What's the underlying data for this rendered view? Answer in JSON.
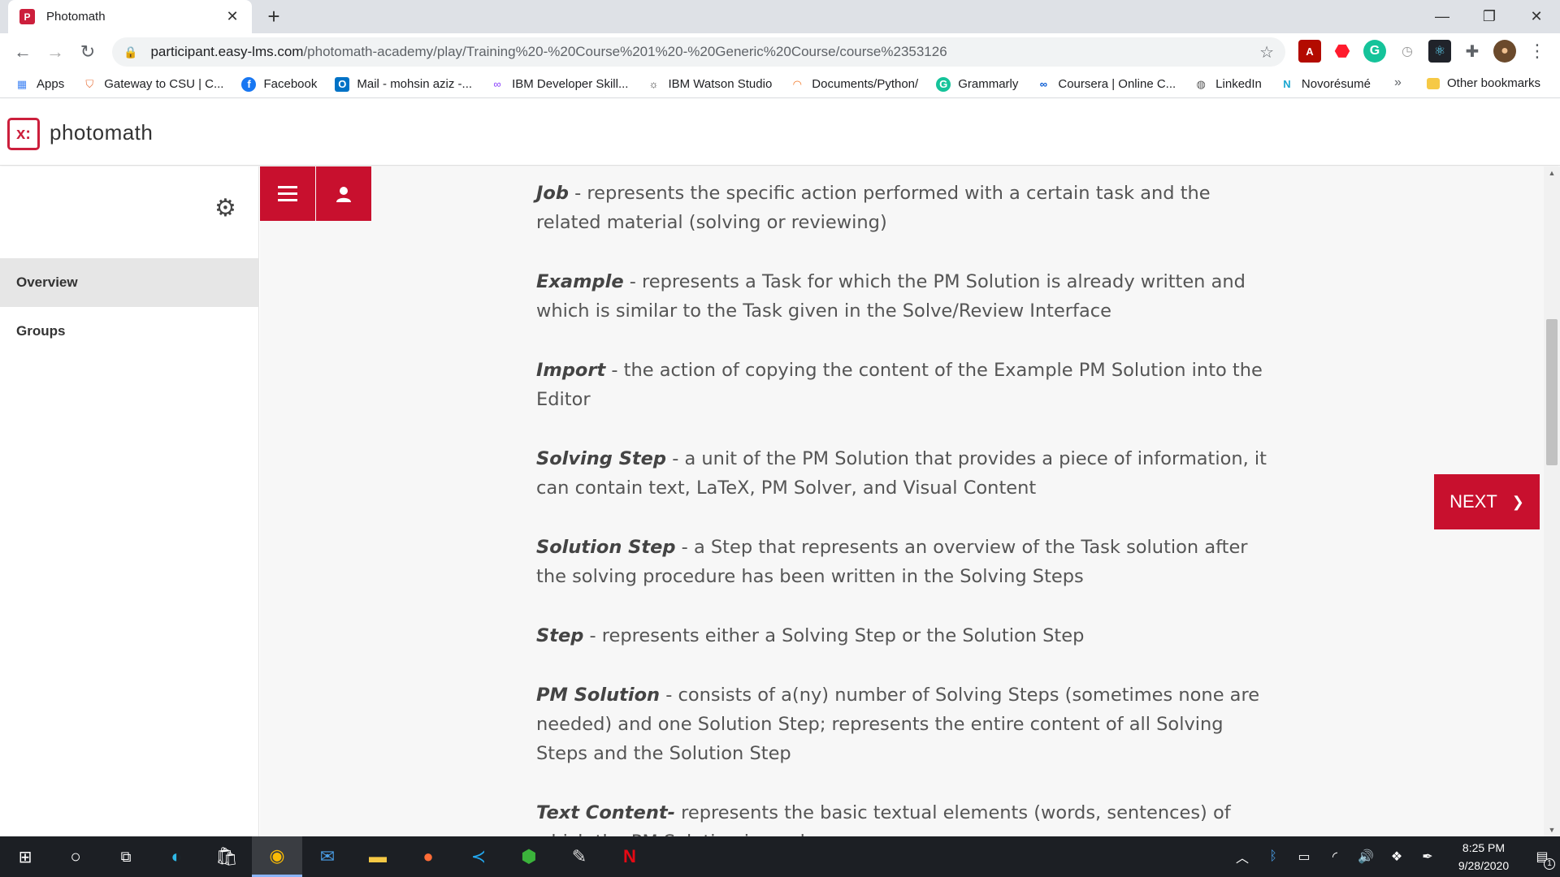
{
  "browser": {
    "tab": {
      "favicon_letter": "P",
      "title": "Photomath"
    },
    "url_domain": "participant.easy-lms.com",
    "url_path": "/photomath-academy/play/Training%20-%20Course%201%20-%20Generic%20Course/course%2353126",
    "bookmarks": [
      {
        "label": "Apps",
        "icon": "apps-grid-icon",
        "color": "#4285f4"
      },
      {
        "label": "Gateway to CSU | C...",
        "icon": "shield-icon",
        "color": "#e8703a"
      },
      {
        "label": "Facebook",
        "icon": "facebook-icon",
        "color": "#1877f2"
      },
      {
        "label": "Mail - mohsin aziz -...",
        "icon": "outlook-icon",
        "color": "#0072c6"
      },
      {
        "label": "IBM Developer Skill...",
        "icon": "ibm-icon",
        "color": "#8a3ffc"
      },
      {
        "label": "IBM Watson Studio",
        "icon": "watson-icon",
        "color": "#333333"
      },
      {
        "label": "Documents/Python/",
        "icon": "jupyter-icon",
        "color": "#f37726"
      },
      {
        "label": "Grammarly",
        "icon": "grammarly-icon",
        "color": "#15c39a"
      },
      {
        "label": "Coursera | Online C...",
        "icon": "coursera-icon",
        "color": "#0056d2"
      },
      {
        "label": "LinkedIn",
        "icon": "globe-icon",
        "color": "#555555"
      },
      {
        "label": "Novorésumé",
        "icon": "novoresume-icon",
        "color": "#1aa6d0"
      }
    ],
    "bookmarks_more": "»",
    "other_bookmarks": "Other bookmarks"
  },
  "app": {
    "logo_text": "photomath",
    "brand_color": "#c8102e"
  },
  "sidebar": {
    "items": [
      {
        "label": "Overview",
        "active": true
      },
      {
        "label": "Groups",
        "active": false
      }
    ]
  },
  "content": {
    "definitions": [
      {
        "term": "Job",
        "sep": " - ",
        "text": "represents the specific action performed with a certain task and the related material (solving or reviewing)"
      },
      {
        "term": "Example",
        "sep": " - ",
        "text": "represents a Task for which the PM Solution is already written and which is similar to the Task given in the Solve/Review Interface"
      },
      {
        "term": "Import",
        "sep": " - ",
        "text": "the action of copying the content of the Example PM Solution into the Editor"
      },
      {
        "term": "Solving Step",
        "sep": " - ",
        "text": "a unit of the PM Solution that provides a piece of information, it can contain text, LaTeX, PM Solver, and Visual Content"
      },
      {
        "term": "Solution Step",
        "sep": " - ",
        "text": "a Step that represents an overview of the Task solution after the solving procedure has been written in the Solving Steps"
      },
      {
        "term": "Step",
        "sep": " - ",
        "text": "represents either a Solving Step or the Solution Step"
      },
      {
        "term": "PM Solution",
        "sep": " - ",
        "text": "consists of a(ny) number of Solving Steps (sometimes none are needed) and one Solution Step; represents the entire content of all Solving Steps and the Solution Step"
      },
      {
        "term": "Text Content-",
        "sep": " ",
        "text": "represents the basic textual elements (words, sentences) of which the PM Solution is made"
      }
    ],
    "next_label": "NEXT"
  },
  "taskbar": {
    "time": "8:25 PM",
    "date": "9/28/2020",
    "notification_count": "1"
  }
}
